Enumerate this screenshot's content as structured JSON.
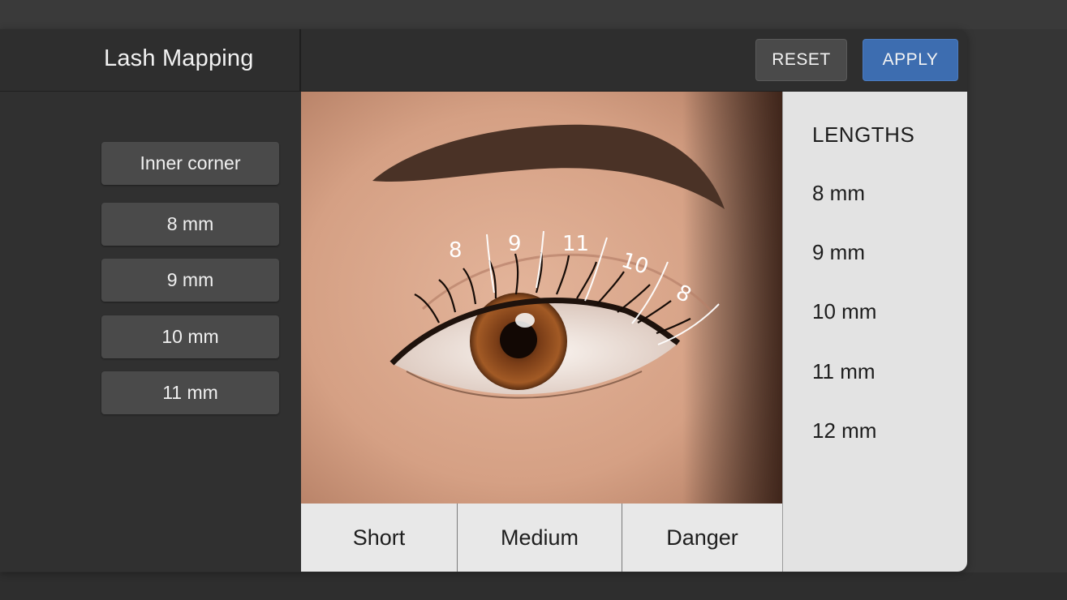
{
  "window": {
    "title": "Lash Mapping"
  },
  "toolbar": {
    "reset_label": "RESET",
    "apply_label": "APPLY"
  },
  "sidebar": {
    "items": [
      {
        "label": "Inner corner"
      },
      {
        "label": "8 mm"
      },
      {
        "label": "9 mm"
      },
      {
        "label": "10 mm"
      },
      {
        "label": "11 mm"
      }
    ]
  },
  "eye_map": {
    "labels": [
      "8",
      "9",
      "11",
      "10",
      "8"
    ]
  },
  "tabs": [
    {
      "label": "Short"
    },
    {
      "label": "Medium"
    },
    {
      "label": "Danger"
    }
  ],
  "lengths_panel": {
    "heading": "LENGTHS",
    "items": [
      {
        "label": "8 mm"
      },
      {
        "label": "9 mm"
      },
      {
        "label": "10 mm"
      },
      {
        "label": "11 mm"
      },
      {
        "label": "12 mm"
      }
    ]
  },
  "colors": {
    "accent": "#3d6db0",
    "background": "#303030",
    "panel": "#e3e3e3"
  }
}
